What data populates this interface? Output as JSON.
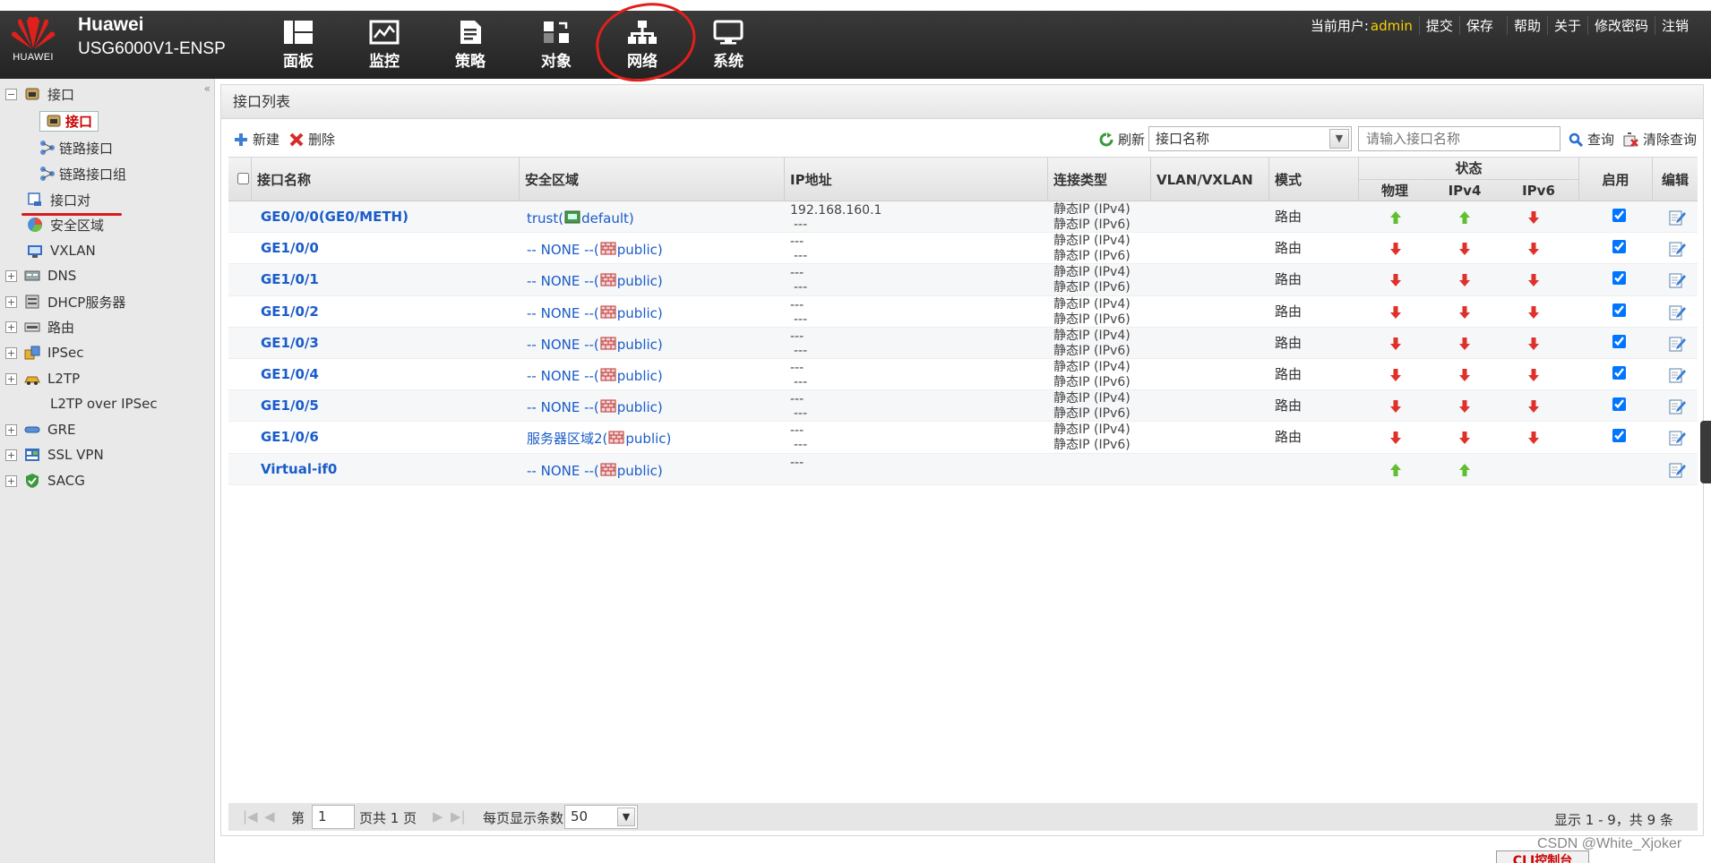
{
  "header": {
    "brand_name": "Huawei",
    "brand_model": "USG6000V1-ENSP",
    "logo_text": "HUAWEI",
    "nav": [
      {
        "label": "面板",
        "icon": "dashboard-icon"
      },
      {
        "label": "监控",
        "icon": "monitor-icon"
      },
      {
        "label": "策略",
        "icon": "policy-icon"
      },
      {
        "label": "对象",
        "icon": "object-icon"
      },
      {
        "label": "网络",
        "icon": "network-icon"
      },
      {
        "label": "系统",
        "icon": "system-icon"
      }
    ],
    "active_nav": "网络",
    "current_user_label": "当前用户:",
    "username": "admin",
    "links": [
      "提交",
      "保存",
      "帮助",
      "关于",
      "修改密码",
      "注销"
    ]
  },
  "sidebar": {
    "items": [
      {
        "label": "接口",
        "toggle": "−",
        "level": 0
      },
      {
        "label": "接口",
        "level": 1,
        "selected": true
      },
      {
        "label": "链路接口",
        "level": 1
      },
      {
        "label": "链路接口组",
        "level": 1
      },
      {
        "label": "接口对",
        "level": 0
      },
      {
        "label": "安全区域",
        "level": 0
      },
      {
        "label": "VXLAN",
        "level": 0
      },
      {
        "label": "DNS",
        "toggle": "+",
        "level": 0
      },
      {
        "label": "DHCP服务器",
        "toggle": "+",
        "level": 0
      },
      {
        "label": "路由",
        "toggle": "+",
        "level": 0
      },
      {
        "label": "IPSec",
        "toggle": "+",
        "level": 0
      },
      {
        "label": "L2TP",
        "toggle": "+",
        "level": 0
      },
      {
        "label": "L2TP over IPSec",
        "level": 0
      },
      {
        "label": "GRE",
        "toggle": "+",
        "level": 0
      },
      {
        "label": "SSL VPN",
        "toggle": "+",
        "level": 0
      },
      {
        "label": "SACG",
        "toggle": "+",
        "level": 0
      }
    ]
  },
  "main": {
    "title": "接口列表",
    "toolbar": {
      "new": "新建",
      "delete": "删除",
      "refresh": "刷新",
      "search_field": "接口名称",
      "search_placeholder": "请输入接口名称",
      "query": "查询",
      "clear": "清除查询"
    },
    "columns": {
      "name": "接口名称",
      "zone": "安全区域",
      "ip": "IP地址",
      "conn": "连接类型",
      "vlan": "VLAN/VXLAN",
      "mode": "模式",
      "status": "状态",
      "phys": "物理",
      "ipv4": "IPv4",
      "ipv6": "IPv6",
      "enable": "启用",
      "edit": "编辑"
    },
    "rows": [
      {
        "name": "GE0/0/0(GE0/METH)",
        "zone": "trust(",
        "vsys": "default)",
        "ip1": "192.168.160.1",
        "ip2": "---",
        "conn1": "静态IP (IPv4)",
        "conn2": "静态IP (IPv6)",
        "mode": "路由",
        "phys": "up",
        "ipv4": "up",
        "ipv6": "down",
        "enabled": true
      },
      {
        "name": "GE1/0/0",
        "zone": "-- NONE --(",
        "vsys": "public)",
        "ip1": "---",
        "ip2": "---",
        "conn1": "静态IP (IPv4)",
        "conn2": "静态IP (IPv6)",
        "mode": "路由",
        "phys": "down",
        "ipv4": "down",
        "ipv6": "down",
        "enabled": true
      },
      {
        "name": "GE1/0/1",
        "zone": "-- NONE --(",
        "vsys": "public)",
        "ip1": "---",
        "ip2": "---",
        "conn1": "静态IP (IPv4)",
        "conn2": "静态IP (IPv6)",
        "mode": "路由",
        "phys": "down",
        "ipv4": "down",
        "ipv6": "down",
        "enabled": true
      },
      {
        "name": "GE1/0/2",
        "zone": "-- NONE --(",
        "vsys": "public)",
        "ip1": "---",
        "ip2": "---",
        "conn1": "静态IP (IPv4)",
        "conn2": "静态IP (IPv6)",
        "mode": "路由",
        "phys": "down",
        "ipv4": "down",
        "ipv6": "down",
        "enabled": true
      },
      {
        "name": "GE1/0/3",
        "zone": "-- NONE --(",
        "vsys": "public)",
        "ip1": "---",
        "ip2": "---",
        "conn1": "静态IP (IPv4)",
        "conn2": "静态IP (IPv6)",
        "mode": "路由",
        "phys": "down",
        "ipv4": "down",
        "ipv6": "down",
        "enabled": true
      },
      {
        "name": "GE1/0/4",
        "zone": "-- NONE --(",
        "vsys": "public)",
        "ip1": "---",
        "ip2": "---",
        "conn1": "静态IP (IPv4)",
        "conn2": "静态IP (IPv6)",
        "mode": "路由",
        "phys": "down",
        "ipv4": "down",
        "ipv6": "down",
        "enabled": true
      },
      {
        "name": "GE1/0/5",
        "zone": "-- NONE --(",
        "vsys": "public)",
        "ip1": "---",
        "ip2": "---",
        "conn1": "静态IP (IPv4)",
        "conn2": "静态IP (IPv6)",
        "mode": "路由",
        "phys": "down",
        "ipv4": "down",
        "ipv6": "down",
        "enabled": true
      },
      {
        "name": "GE1/0/6",
        "zone": "服务器区域2(",
        "vsys": "public)",
        "ip1": "---",
        "ip2": "---",
        "conn1": "静态IP (IPv4)",
        "conn2": "静态IP (IPv6)",
        "mode": "路由",
        "phys": "down",
        "ipv4": "down",
        "ipv6": "down",
        "enabled": true
      },
      {
        "name": "Virtual-if0",
        "zone": "-- NONE --(",
        "vsys": "public)",
        "ip1": "---",
        "ip2": "",
        "conn1": "",
        "conn2": "",
        "mode": "",
        "phys": "up",
        "ipv4": "up",
        "ipv6": "",
        "enabled": null
      }
    ],
    "pager": {
      "page_prefix": "第",
      "page": "1",
      "page_suffix": "页共 1 页",
      "per_page_label": "每页显示条数",
      "per_page": "50",
      "summary": "显示 1 - 9，共 9 条"
    }
  },
  "footer": {
    "watermark": "CSDN @White_Xjoker",
    "cli_button": "CLI控制台"
  },
  "colors": {
    "up": "#5fbf2f",
    "down": "#e0302a",
    "link": "#1a5cc8",
    "accent_red": "#e0201b",
    "user": "#f5d000"
  }
}
